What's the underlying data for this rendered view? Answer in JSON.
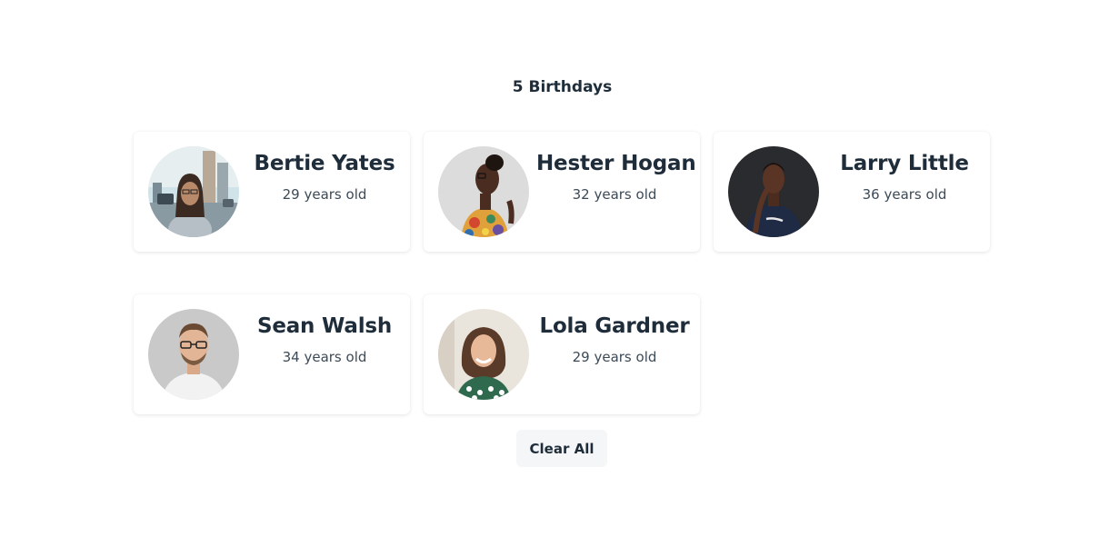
{
  "header": {
    "title": "5 Birthdays"
  },
  "people": [
    {
      "name": "Bertie Yates",
      "age": "29 years old",
      "photo": "avatar-woman-city-street"
    },
    {
      "name": "Hester Hogan",
      "age": "32 years old",
      "photo": "avatar-woman-floral-top"
    },
    {
      "name": "Larry Little",
      "age": "36 years old",
      "photo": "avatar-man-dark-background"
    },
    {
      "name": "Sean Walsh",
      "age": "34 years old",
      "photo": "avatar-man-glasses"
    },
    {
      "name": "Lola Gardner",
      "age": "29 years old",
      "photo": "avatar-woman-curly-hair"
    }
  ],
  "actions": {
    "clear_label": "Clear All"
  }
}
